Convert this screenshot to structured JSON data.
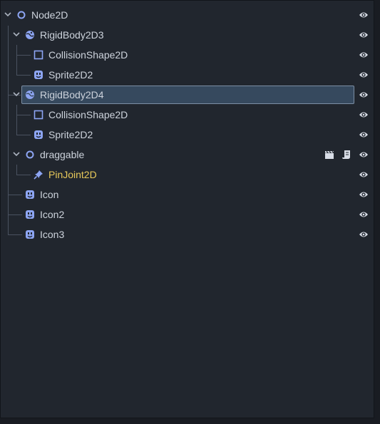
{
  "scene_tree": {
    "nodes": [
      {
        "label": "Node2D",
        "depth": 0,
        "icon": "node2d-circle-icon",
        "expanded": true
      },
      {
        "label": "RigidBody2D3",
        "depth": 1,
        "icon": "rigidbody-globe-icon",
        "expanded": true
      },
      {
        "label": "CollisionShape2D",
        "depth": 2,
        "icon": "collision-shape-square-icon"
      },
      {
        "label": "Sprite2D2",
        "depth": 2,
        "icon": "sprite-face-icon"
      },
      {
        "label": "RigidBody2D4",
        "depth": 1,
        "icon": "rigidbody-globe-icon",
        "expanded": true,
        "selected": true
      },
      {
        "label": "CollisionShape2D",
        "depth": 2,
        "icon": "collision-shape-square-icon"
      },
      {
        "label": "Sprite2D2",
        "depth": 2,
        "icon": "sprite-face-icon"
      },
      {
        "label": "draggable",
        "depth": 1,
        "icon": "node2d-circle-icon",
        "expanded": true,
        "extras": [
          "clapperboard-icon",
          "script-icon"
        ]
      },
      {
        "label": "PinJoint2D",
        "depth": 2,
        "icon": "pin-joint-icon",
        "warning": true
      },
      {
        "label": "Icon",
        "depth": 1,
        "icon": "sprite-face-icon"
      },
      {
        "label": "Icon2",
        "depth": 1,
        "icon": "sprite-face-icon"
      },
      {
        "label": "Icon3",
        "depth": 1,
        "icon": "sprite-face-icon"
      }
    ]
  },
  "colors": {
    "background": "#21262e",
    "text": "#cdd3dc",
    "warning_text": "#e8c95a",
    "icon_accent": "#8da5f3",
    "selection": "#36495e"
  }
}
